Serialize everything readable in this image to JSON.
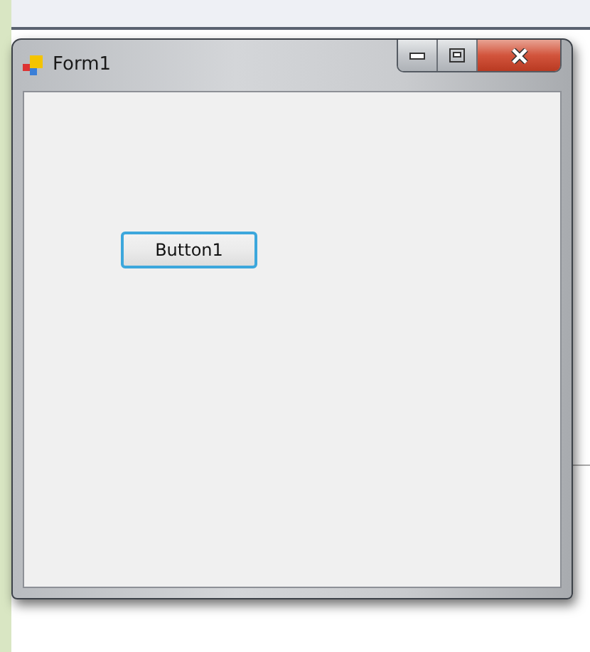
{
  "window": {
    "title": "Form1"
  },
  "form": {
    "button": {
      "label": "Button1",
      "focused": true
    }
  }
}
